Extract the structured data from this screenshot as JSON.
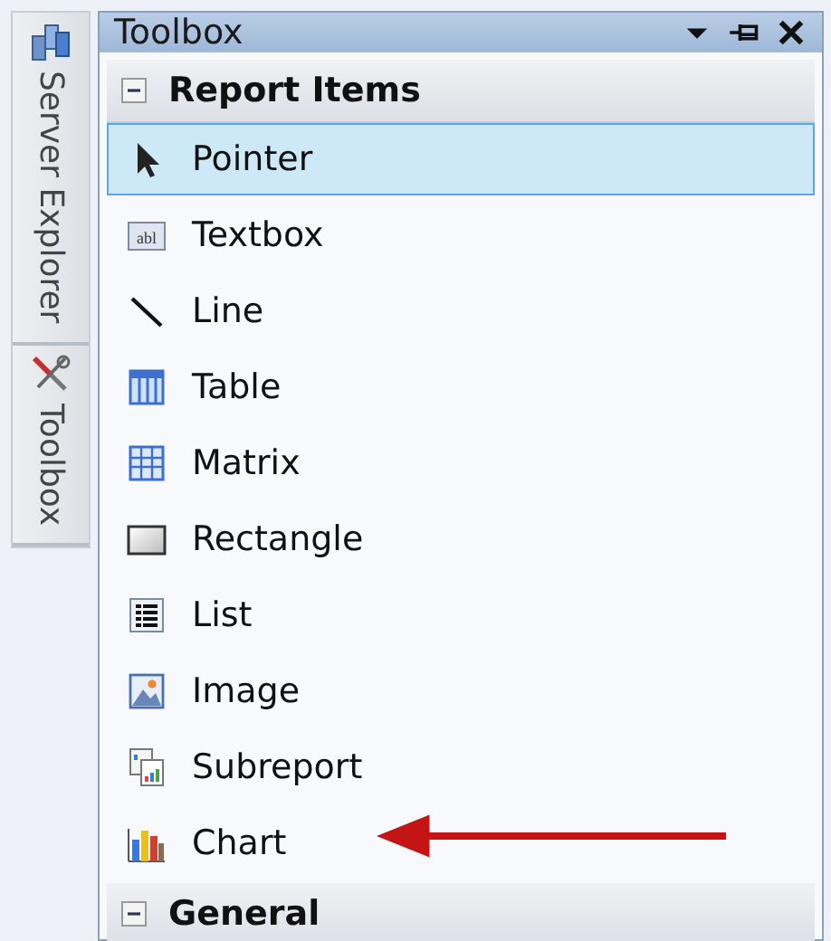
{
  "side_tabs": [
    {
      "label": "Server Explorer",
      "kind": "server"
    },
    {
      "label": "Toolbox",
      "kind": "tools"
    }
  ],
  "toolbox": {
    "title": "Toolbox",
    "groups": [
      {
        "label": "Report Items",
        "expanded": true,
        "items": [
          {
            "label": "Pointer",
            "kind": "pointer",
            "selected": true
          },
          {
            "label": "Textbox",
            "kind": "textbox",
            "icon_text": "abl",
            "selected": false
          },
          {
            "label": "Line",
            "kind": "line",
            "selected": false
          },
          {
            "label": "Table",
            "kind": "table",
            "selected": false
          },
          {
            "label": "Matrix",
            "kind": "matrix",
            "selected": false
          },
          {
            "label": "Rectangle",
            "kind": "rectangle",
            "selected": false
          },
          {
            "label": "List",
            "kind": "list",
            "selected": false
          },
          {
            "label": "Image",
            "kind": "image",
            "selected": false
          },
          {
            "label": "Subreport",
            "kind": "subreport",
            "selected": false
          },
          {
            "label": "Chart",
            "kind": "chart",
            "selected": false
          }
        ]
      },
      {
        "label": "General",
        "expanded": true
      }
    ]
  }
}
